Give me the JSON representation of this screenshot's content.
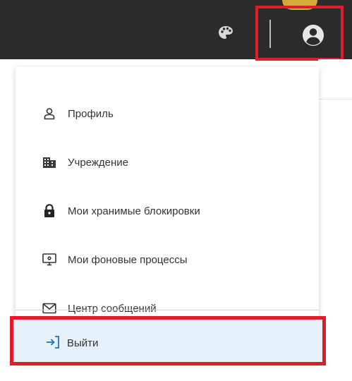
{
  "header": {
    "palette_icon": "palette-icon",
    "account_icon": "account-circle-icon",
    "colors": {
      "bar_background": "#2b2b2b",
      "highlight_border": "#e21b2a",
      "accent_sliver": "#f3c23a"
    }
  },
  "menu": {
    "items": [
      {
        "label": "Профиль",
        "icon": "user-icon"
      },
      {
        "label": "Учреждение",
        "icon": "building-icon"
      },
      {
        "label": "Мои хранимые блокировки",
        "icon": "lock-icon"
      },
      {
        "label": "Мои фоновые процессы",
        "icon": "monitor-gear-icon"
      },
      {
        "label": "Центр сообщений",
        "icon": "envelope-icon"
      }
    ],
    "logout": {
      "label": "Выйти",
      "icon": "logout-icon"
    },
    "colors": {
      "logout_background": "#e7f1fb",
      "logout_icon": "#1e73c8",
      "text": "#333333"
    }
  }
}
